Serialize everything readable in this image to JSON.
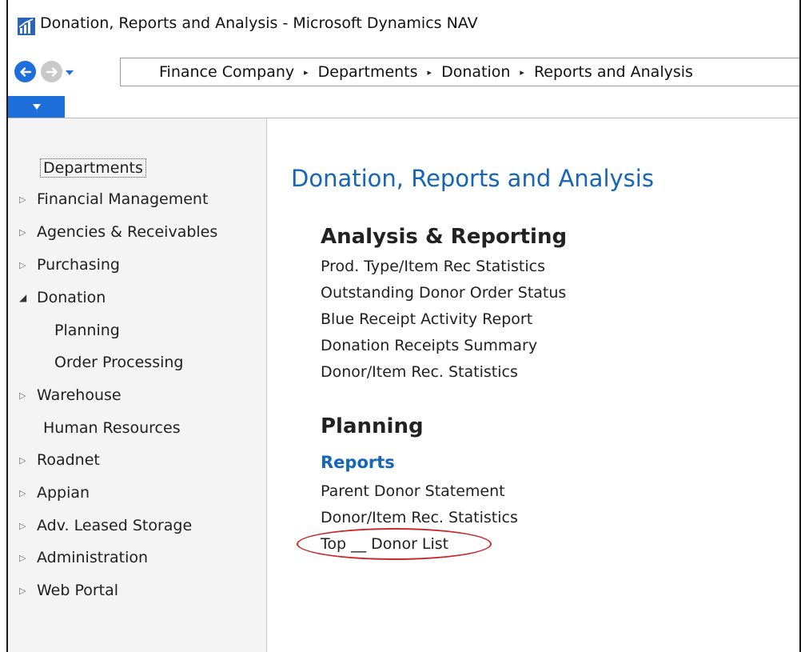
{
  "window": {
    "title": "Donation, Reports and Analysis - Microsoft Dynamics NAV",
    "app_icon": "dynamics-nav-chart-icon"
  },
  "navigation": {
    "back_icon": "back-arrow-icon",
    "forward_icon": "forward-arrow-icon",
    "history_icon": "chevron-down-icon",
    "breadcrumbs": [
      "Finance Company",
      "Departments",
      "Donation",
      "Reports and Analysis"
    ],
    "separator": "▸"
  },
  "ribbon": {
    "toggle_icon": "chevron-down-icon"
  },
  "sidebar": {
    "root": "Departments",
    "items": [
      {
        "label": "Financial Management",
        "state": "collapsed"
      },
      {
        "label": "Agencies & Receivables",
        "state": "collapsed"
      },
      {
        "label": "Purchasing",
        "state": "collapsed"
      },
      {
        "label": "Donation",
        "state": "expanded"
      },
      {
        "label": "Planning",
        "state": "child"
      },
      {
        "label": "Order Processing",
        "state": "child"
      },
      {
        "label": "Warehouse",
        "state": "collapsed"
      },
      {
        "label": "Human Resources",
        "state": "leaf"
      },
      {
        "label": "Roadnet",
        "state": "collapsed"
      },
      {
        "label": "Appian",
        "state": "collapsed"
      },
      {
        "label": "Adv. Leased Storage",
        "state": "collapsed"
      },
      {
        "label": "Administration",
        "state": "collapsed"
      },
      {
        "label": "Web Portal",
        "state": "collapsed"
      }
    ]
  },
  "main": {
    "title": "Donation, Reports and Analysis",
    "sections": [
      {
        "heading": "Analysis & Reporting",
        "links": [
          "Prod. Type/Item Rec Statistics",
          "Outstanding Donor Order Status",
          "Blue Receipt Activity Report",
          "Donation Receipts Summary",
          "Donor/Item Rec. Statistics"
        ]
      },
      {
        "heading": "Planning",
        "subheading": "Reports",
        "links": [
          "Parent Donor Statement",
          "Donor/Item Rec. Statistics",
          "Top __ Donor List"
        ]
      }
    ]
  },
  "colors": {
    "accent": "#1e6fd9",
    "title_blue": "#1565b8",
    "highlight_ring": "#c42b2b"
  }
}
